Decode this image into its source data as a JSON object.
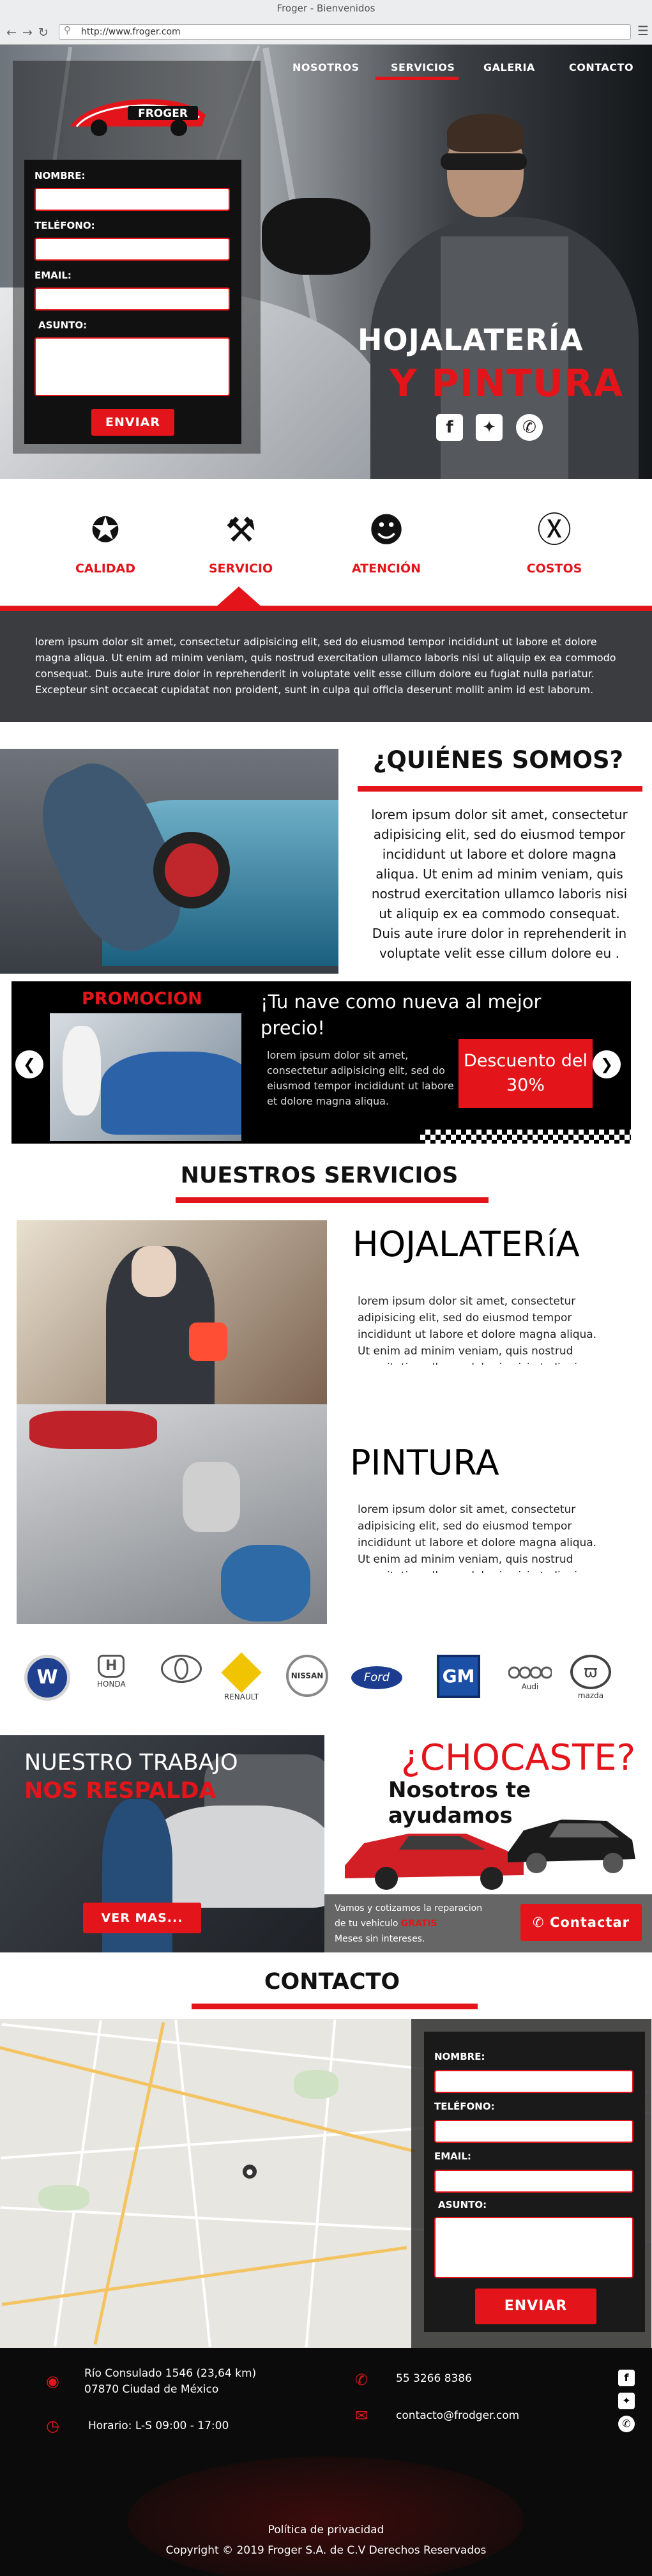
{
  "browser": {
    "window_title": "Froger - Bienvenidos",
    "nav_icons": [
      "back-icon",
      "forward-icon",
      "reload-icon"
    ],
    "url": "http://www.froger.com",
    "search_icon": "search-icon",
    "menu_icon": "menu-icon"
  },
  "brand": {
    "name": "FROGER",
    "accent": "#e3151a"
  },
  "hero": {
    "form": {
      "fields": [
        {
          "label": "NOMBRE:",
          "value": ""
        },
        {
          "label": "TELÉFONO:",
          "value": ""
        },
        {
          "label": "EMAIL:",
          "value": ""
        },
        {
          "label": "ASUNTO:",
          "value": ""
        }
      ],
      "submit": "ENVIAR"
    },
    "nav": [
      {
        "label": "NOSOTROS",
        "active": false
      },
      {
        "label": "SERVICIOS",
        "active": true
      },
      {
        "label": "GALERIA",
        "active": false
      },
      {
        "label": "CONTACTO",
        "active": false
      }
    ],
    "title_line1": "HOJALATERÍA",
    "title_line2": "Y PINTURA",
    "social": [
      "facebook-icon",
      "twitter-icon",
      "whatsapp-icon"
    ]
  },
  "features": [
    {
      "label": "CALIDAD",
      "icon": "award-ribbon-icon",
      "active": false
    },
    {
      "label": "SERVICIO",
      "icon": "tools-icon",
      "active": true
    },
    {
      "label": "ATENCIÓN",
      "icon": "headset-agent-icon",
      "active": false
    },
    {
      "label": "COSTOS",
      "icon": "money-hand-icon",
      "active": false
    }
  ],
  "feature_text": "lorem ipsum dolor sit amet, consectetur adipisicing elit, sed do eiusmod tempor incididunt ut labore et dolore magna aliqua. Ut enim ad minim veniam, quis nostrud exercitation ullamco laboris nisi ut aliquip ex ea commodo consequat. Duis aute irure dolor in reprehenderit in voluptate velit esse cillum dolore eu fugiat nulla pariatur. Excepteur sint occaecat cupidatat non proident, sunt in culpa qui officia deserunt mollit anim id est laborum.",
  "about": {
    "title": "¿QUIÉNES SOMOS?",
    "text": "lorem ipsum dolor sit amet, consectetur adipisicing elit, sed do eiusmod tempor incididunt ut labore et dolore magna aliqua. Ut enim ad minim veniam, quis nostrud exercitation ullamco laboris nisi ut aliquip ex ea commodo consequat. Duis aute irure dolor in reprehenderit in voluptate velit esse cillum dolore eu ."
  },
  "promo": {
    "label": "PROMOCION",
    "headline": "¡Tu nave como nueva al mejor precio!",
    "text": "lorem ipsum dolor sit amet, consectetur adipisicing elit, sed do eiusmod tempor incididunt ut labore et dolore magna aliqua.",
    "badge": "Descuento del 30%",
    "prev_icon": "arrow-left-icon",
    "next_icon": "arrow-right-icon"
  },
  "services": {
    "title": "NUESTROS SERVICIOS",
    "items": [
      {
        "title": "HOJALATERíA",
        "text": "lorem ipsum dolor sit amet, consectetur adipisicing elit, sed do eiusmod tempor incididunt ut labore et dolore magna aliqua. Ut enim ad minim veniam, quis nostrud exercitation ullamco laboris nisi ut aliquip ex ea commodo consequat."
      },
      {
        "title": "PINTURA",
        "text": "lorem ipsum dolor sit amet, consectetur adipisicing elit, sed do eiusmod tempor incididunt ut labore et dolore magna aliqua. Ut enim ad minim veniam, quis nostrud exercitation ullamco laboris nisi ut aliquip ex ea commodo consequat."
      }
    ]
  },
  "brands": [
    {
      "name": "",
      "logo": "volkswagen-logo"
    },
    {
      "name": "HONDA",
      "logo": "honda-logo"
    },
    {
      "name": "",
      "logo": "toyota-logo"
    },
    {
      "name": "RENAULT",
      "logo": "renault-logo"
    },
    {
      "name": "NISSAN",
      "logo": "nissan-logo"
    },
    {
      "name": "Ford",
      "logo": "ford-logo"
    },
    {
      "name": "GM",
      "logo": "gm-logo"
    },
    {
      "name": "Audi",
      "logo": "audi-logo"
    },
    {
      "name": "mazda",
      "logo": "mazda-logo"
    }
  ],
  "work": {
    "line1": "NUESTRO TRABAJO",
    "line2": "NOS RESPALDA",
    "button": "VER MAS..."
  },
  "crash": {
    "title": "¿CHOCASTE?",
    "subtitle": "Nosotros te ayudamos",
    "text_before": "Vamos y cotizamos la reparacion de tu vehiculo ",
    "text_highlight": "GRATIS",
    "text_after": "Meses sin intereses.",
    "button": "Contactar",
    "button_icon": "whatsapp-icon"
  },
  "contact": {
    "title": "CONTACTO",
    "map_icon": "map-pin-icon",
    "form": {
      "fields": [
        {
          "label": "NOMBRE:",
          "value": ""
        },
        {
          "label": "TELÉFONO:",
          "value": ""
        },
        {
          "label": "EMAIL:",
          "value": ""
        },
        {
          "label": "ASUNTO:",
          "value": ""
        }
      ],
      "submit": "ENVIAR"
    }
  },
  "footer": {
    "address": "Río Consulado 1546 (23,64 km) 07870 Ciudad de México",
    "hours": "Horario: L-S 09:00 - 17:00",
    "phone": "55 3266 8386",
    "email": "contacto@frodger.com",
    "icons": {
      "address": "location-pin-icon",
      "hours": "clock-icon",
      "phone": "phone-icon",
      "email": "envelope-icon"
    },
    "social": [
      "facebook-icon",
      "twitter-icon",
      "whatsapp-icon"
    ],
    "privacy": "Política de privacidad",
    "copyright": "Copyright © 2019 Froger S.A. de C.V Derechos Reservados"
  }
}
